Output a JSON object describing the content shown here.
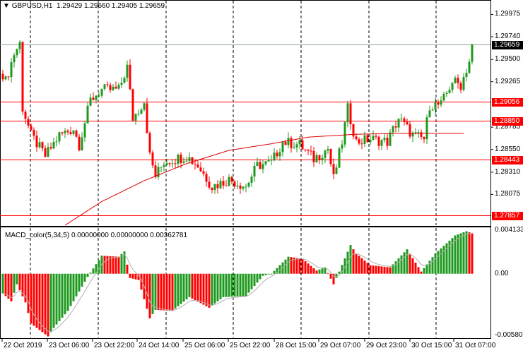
{
  "header": {
    "symbol": "GBPUSD,H1",
    "open": "1.29429",
    "high": "1.29660",
    "low": "1.29405",
    "close": "1.29659"
  },
  "macd_header": {
    "name": "MACD_color(5,34,5)",
    "v1": "0.00000000",
    "v2": "0.00000000",
    "v3": "0.00362781"
  },
  "price_axis": [
    "1.29975",
    "1.29740",
    "1.29500",
    "1.29265",
    "1.28785",
    "1.28550",
    "1.28310",
    "1.28075"
  ],
  "price_levels": [
    {
      "label": "1.29659",
      "price": 1.29659,
      "color": "#000000",
      "line": "#8a9aa8"
    },
    {
      "label": "1.29056",
      "price": 1.29056,
      "color": "#ff0000",
      "line": "#ff0000"
    },
    {
      "label": "1.28850",
      "price": 1.2885,
      "color": "#ff0000",
      "line": "#ff0000"
    },
    {
      "label": "1.28443",
      "price": 1.28443,
      "color": "#ff0000",
      "line": "#ff0000"
    },
    {
      "label": "1.27857",
      "price": 1.27857,
      "color": "#ff0000",
      "line": "#ff0000"
    }
  ],
  "macd_axis": [
    "0.0041333",
    "0.00",
    "-0.005802"
  ],
  "time_axis": [
    "22 Oct 2019",
    "23 Oct 06:00",
    "23 Oct 22:00",
    "24 Oct 14:00",
    "25 Oct 06:00",
    "25 Oct 22:00",
    "28 Oct 15:00",
    "29 Oct 07:00",
    "29 Oct 23:00",
    "30 Oct 15:00",
    "31 Oct 07:00"
  ],
  "colors": {
    "bull": "#1e9a1e",
    "bear": "#ff0000",
    "ma": "#e00000",
    "signal": "#b0b0b0",
    "grid": "#000000"
  },
  "chart_data": {
    "type": "candlestick",
    "timeframe": "H1",
    "ylim": [
      1.2775,
      1.3012
    ],
    "bars": 167,
    "close_waypoints": [
      [
        0,
        1.2935
      ],
      [
        1,
        1.2927
      ],
      [
        4,
        1.2956
      ],
      [
        6,
        1.2967
      ],
      [
        7,
        1.2899
      ],
      [
        10,
        1.287
      ],
      [
        15,
        1.2848
      ],
      [
        20,
        1.287
      ],
      [
        25,
        1.2877
      ],
      [
        27,
        1.286
      ],
      [
        31,
        1.2907
      ],
      [
        35,
        1.2918
      ],
      [
        41,
        1.2918
      ],
      [
        44,
        1.2942
      ],
      [
        46,
        1.2888
      ],
      [
        50,
        1.2906
      ],
      [
        52,
        1.2848
      ],
      [
        54,
        1.2827
      ],
      [
        57,
        1.2842
      ],
      [
        65,
        1.2848
      ],
      [
        69,
        1.2838
      ],
      [
        74,
        1.2816
      ],
      [
        80,
        1.2823
      ],
      [
        86,
        1.2816
      ],
      [
        90,
        1.2838
      ],
      [
        95,
        1.2841
      ],
      [
        99,
        1.2863
      ],
      [
        105,
        1.286
      ],
      [
        110,
        1.2845
      ],
      [
        115,
        1.2856
      ],
      [
        117,
        1.2824
      ],
      [
        120,
        1.2863
      ],
      [
        122,
        1.2898
      ],
      [
        125,
        1.2863
      ],
      [
        130,
        1.2866
      ],
      [
        136,
        1.2863
      ],
      [
        140,
        1.2888
      ],
      [
        145,
        1.287
      ],
      [
        149,
        1.2866
      ],
      [
        151,
        1.2902
      ],
      [
        155,
        1.2902
      ],
      [
        159,
        1.2927
      ],
      [
        162,
        1.2923
      ],
      [
        165,
        1.2948
      ],
      [
        166,
        1.29659
      ]
    ],
    "ma_waypoints": [
      [
        22,
        1.2775
      ],
      [
        35,
        1.28
      ],
      [
        50,
        1.2822
      ],
      [
        65,
        1.284
      ],
      [
        80,
        1.2854
      ],
      [
        95,
        1.2861
      ],
      [
        108,
        1.2868
      ],
      [
        125,
        1.2871
      ],
      [
        140,
        1.2872
      ],
      [
        163,
        1.2872
      ]
    ],
    "macd": {
      "ylim": [
        -0.006,
        0.0043
      ],
      "hist_waypoints": [
        [
          0,
          -0.00185
        ],
        [
          3,
          -0.0026
        ],
        [
          5,
          -0.001
        ],
        [
          8,
          -0.0027
        ],
        [
          10,
          -0.0047
        ],
        [
          16,
          -0.0059
        ],
        [
          18,
          -0.0051
        ],
        [
          23,
          -0.0035
        ],
        [
          30,
          -0.0003
        ],
        [
          35,
          0.0017
        ],
        [
          41,
          0.0016
        ],
        [
          43,
          0.0021
        ],
        [
          45,
          -0.0004
        ],
        [
          48,
          -0.0006
        ],
        [
          52,
          -0.0042
        ],
        [
          54,
          -0.0034
        ],
        [
          60,
          -0.0035
        ],
        [
          66,
          -0.0022
        ],
        [
          73,
          -0.0032
        ],
        [
          78,
          -0.0022
        ],
        [
          86,
          -0.0021
        ],
        [
          92,
          -0.0002
        ],
        [
          95,
          0.0
        ],
        [
          101,
          0.0016
        ],
        [
          106,
          0.0014
        ],
        [
          111,
          0.0003
        ],
        [
          114,
          0.0006
        ],
        [
          117,
          -0.001
        ],
        [
          119,
          0.0002
        ],
        [
          123,
          0.0027
        ],
        [
          125,
          0.0019
        ],
        [
          130,
          0.0008
        ],
        [
          137,
          0.0006
        ],
        [
          143,
          0.0023
        ],
        [
          148,
          0.0002
        ],
        [
          153,
          0.0019
        ],
        [
          160,
          0.0036
        ],
        [
          164,
          0.004
        ],
        [
          166,
          0.0038
        ]
      ]
    }
  }
}
